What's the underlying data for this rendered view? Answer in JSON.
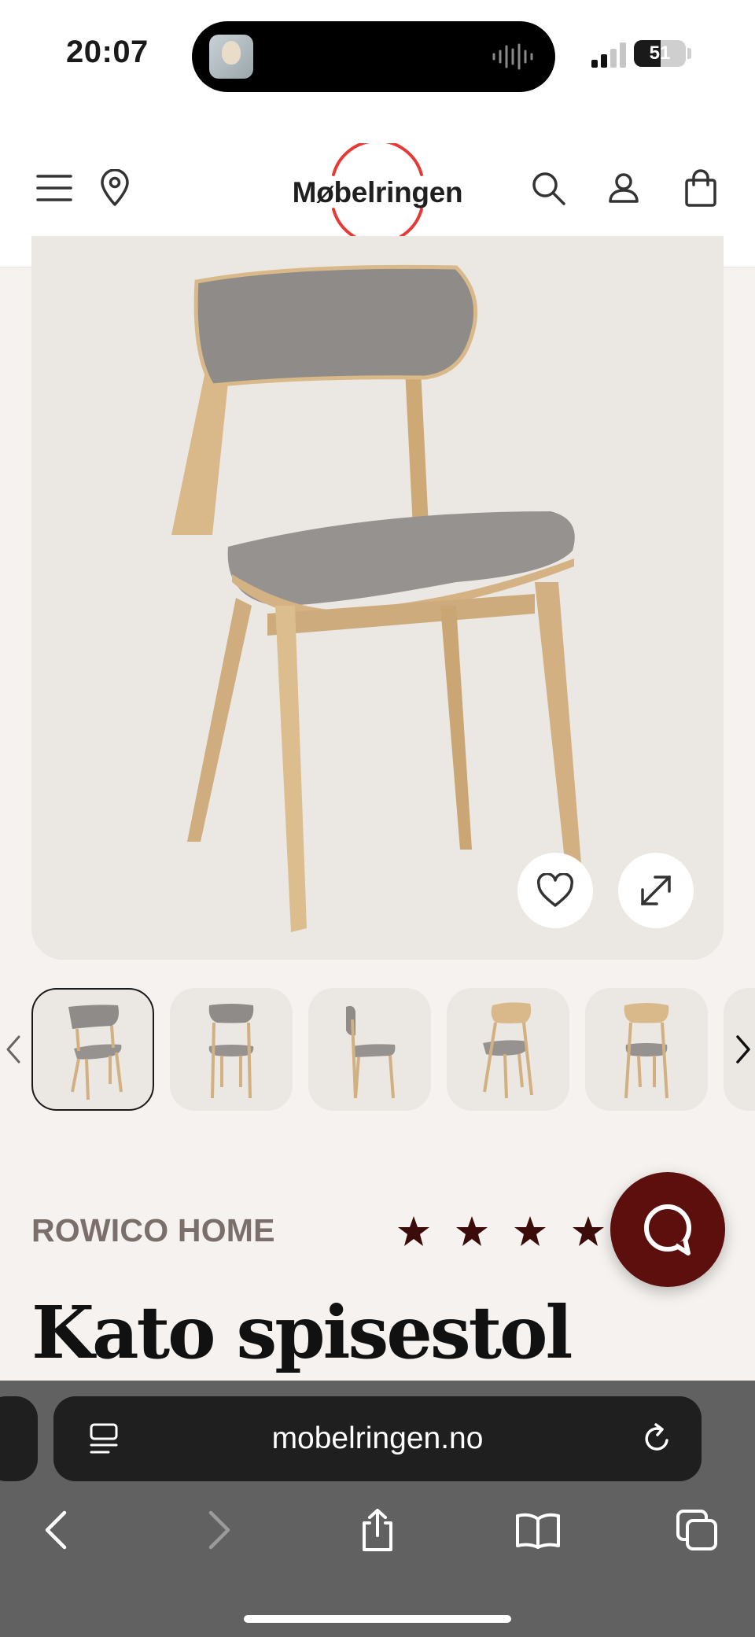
{
  "status_bar": {
    "time": "20:07",
    "battery": "51",
    "battery_level": 0.51
  },
  "header": {
    "logo_text": "Møbelringen",
    "icons": [
      "menu-icon",
      "location-icon",
      "search-icon",
      "account-icon",
      "cart-icon"
    ]
  },
  "gallery": {
    "thumbnail_count": 5,
    "selected_index": 0
  },
  "product": {
    "brand": "ROWICO HOME",
    "name": "Kato spisestol",
    "rating_stars_visible": 4
  },
  "browser": {
    "url": "mobelringen.no"
  },
  "colors": {
    "accent_red": "#e63a36",
    "chat_button": "#5c0f0c",
    "page_bg": "#f5f2ef",
    "image_bg": "#ebe7e2",
    "brand_text": "#7a6f6a"
  }
}
